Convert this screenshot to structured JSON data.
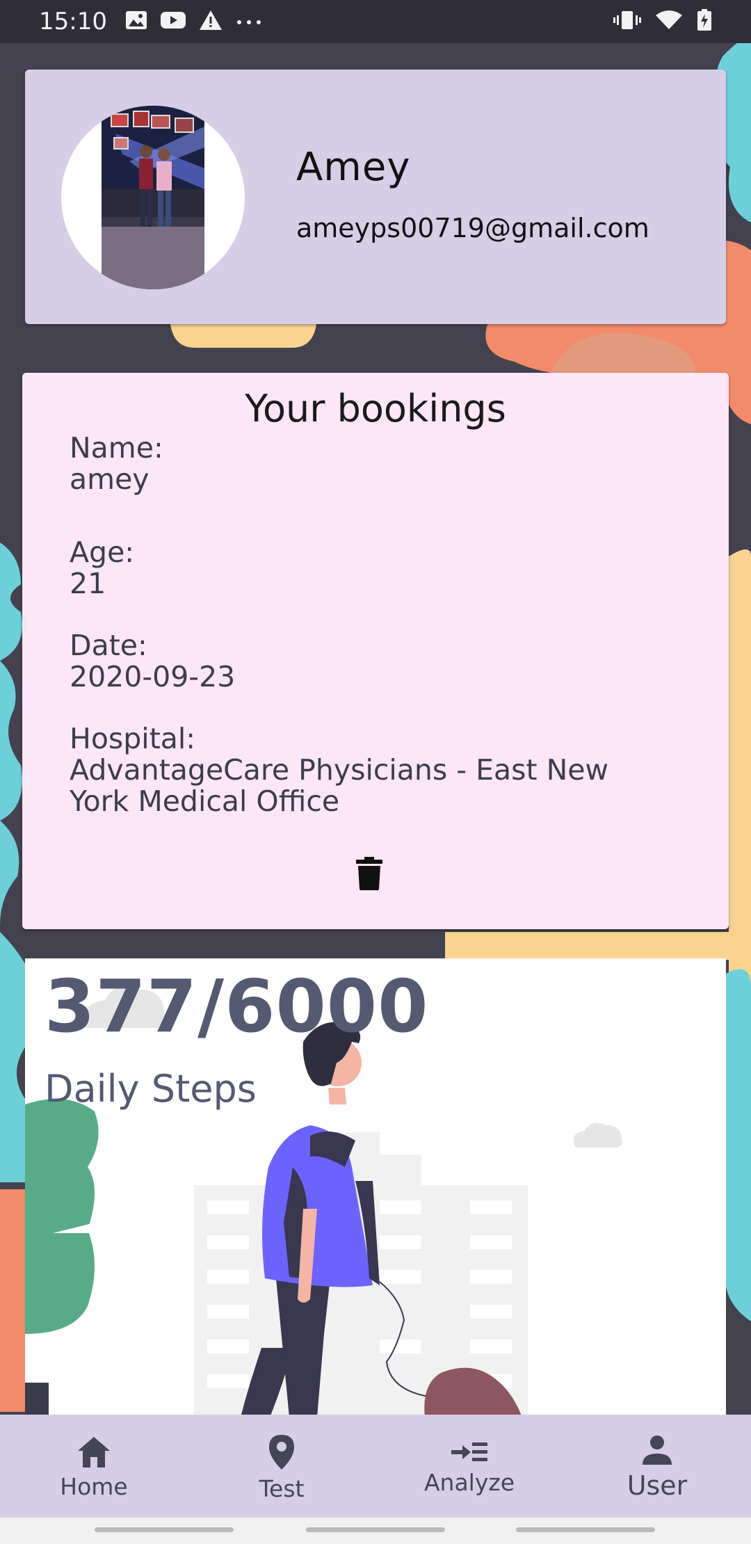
{
  "status_bar": {
    "time": "15:10"
  },
  "profile": {
    "name": "Amey",
    "email": "ameyps00719@gmail.com"
  },
  "bookings": {
    "title": "Your bookings",
    "fields": [
      {
        "label": "Name:",
        "value": "amey"
      },
      {
        "label": "Age:",
        "value": "21"
      },
      {
        "label": "Date:",
        "value": "2020-09-23"
      },
      {
        "label": "Hospital:",
        "value": "AdvantageCare Physicians - East New York Medical Office"
      }
    ],
    "delete_icon": "trash-icon"
  },
  "steps": {
    "count": "377/6000",
    "label": "Daily Steps"
  },
  "nav": {
    "items": [
      {
        "label": "Home",
        "icon": "home-icon"
      },
      {
        "label": "Test",
        "icon": "location-pin-icon"
      },
      {
        "label": "Analyze",
        "icon": "analyze-icon"
      },
      {
        "label": "User",
        "icon": "person-icon"
      }
    ],
    "active": "User"
  },
  "colors": {
    "background": "#44424f",
    "profile_card": "#d6cde7",
    "bookings_card": "#fde6f6",
    "steps_text": "#545a72",
    "nav_bar": "#d6cde7"
  }
}
